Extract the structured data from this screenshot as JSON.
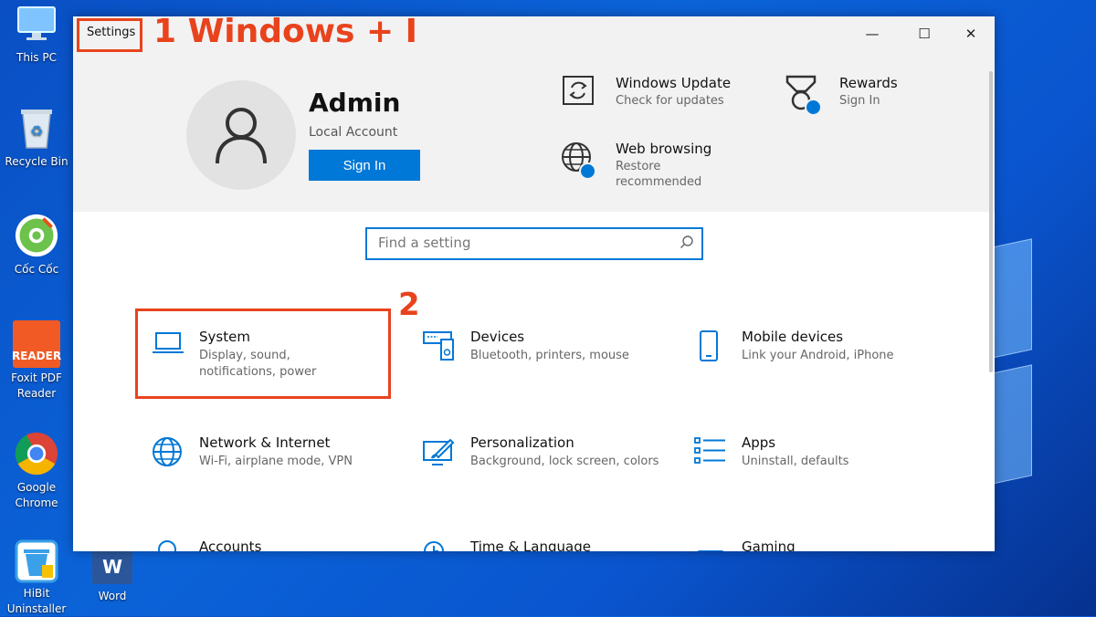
{
  "desktop": {
    "icons": [
      {
        "label": "This PC"
      },
      {
        "label": "Recycle Bin"
      },
      {
        "label": "Cốc Cốc"
      },
      {
        "label": "Foxit PDF Reader"
      },
      {
        "label": "Google Chrome"
      },
      {
        "label": "HiBit Uninstaller"
      },
      {
        "label": "Word"
      }
    ],
    "foxit_badge": "READER",
    "word_badge": "W"
  },
  "window": {
    "title": "Settings",
    "minimize": "—",
    "maximize": "☐",
    "close": "✕"
  },
  "account": {
    "name": "Admin",
    "type": "Local Account",
    "signin_label": "Sign In"
  },
  "quick_links": [
    {
      "title": "Windows Update",
      "subtitle": "Check for updates",
      "icon": "sync-icon"
    },
    {
      "title": "Rewards",
      "subtitle": "Sign In",
      "icon": "medal-icon"
    },
    {
      "title": "Web browsing",
      "subtitle": "Restore recommended",
      "icon": "globe-icon"
    }
  ],
  "search": {
    "placeholder": "Find a setting"
  },
  "categories": [
    {
      "title": "System",
      "desc": "Display, sound, notifications, power",
      "icon": "laptop-icon"
    },
    {
      "title": "Devices",
      "desc": "Bluetooth, printers, mouse",
      "icon": "keyboard-speaker-icon"
    },
    {
      "title": "Mobile devices",
      "desc": "Link your Android, iPhone",
      "icon": "phone-icon"
    },
    {
      "title": "Network & Internet",
      "desc": "Wi-Fi, airplane mode, VPN",
      "icon": "globe-icon"
    },
    {
      "title": "Personalization",
      "desc": "Background, lock screen, colors",
      "icon": "paint-icon"
    },
    {
      "title": "Apps",
      "desc": "Uninstall, defaults",
      "icon": "list-icon"
    },
    {
      "title": "Accounts",
      "desc": "",
      "icon": "person-icon"
    },
    {
      "title": "Time & Language",
      "desc": "",
      "icon": "clock-icon"
    },
    {
      "title": "Gaming",
      "desc": "",
      "icon": "gamepad-icon"
    }
  ],
  "annotations": {
    "step1": "1 Windows + I",
    "step2": "2"
  },
  "colors": {
    "accent": "#0078d7",
    "annotation": "#e8431d"
  }
}
